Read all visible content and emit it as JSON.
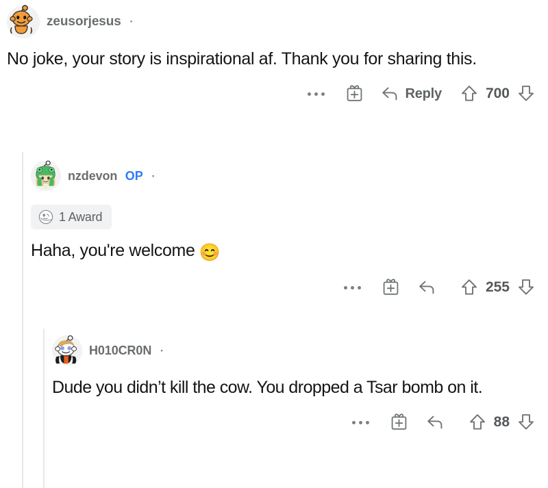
{
  "app": {
    "platform": "reddit",
    "view": "comment-thread",
    "background_color": "#ffffff",
    "text_color": "#141414",
    "meta_color": "#6f7375",
    "op_badge_color": "#2d7cf6",
    "threadline_color": "#e6e7e8"
  },
  "comments": [
    {
      "id": "comment-1",
      "depth": 0,
      "username": "zeusorjesus",
      "is_op": false,
      "op_label": "",
      "separator": "·",
      "timestamp": "",
      "avatar": {
        "name": "snoo-avatar-orange",
        "body_color": "#f29c38",
        "accent_color": "#f0882c",
        "background_color": "#f2f2f3"
      },
      "awards": null,
      "body": "No joke, your story is inspirational af. Thank you for sharing this.",
      "emoji": "",
      "actions": {
        "overflow_label": "…",
        "overflow_name": "more-options",
        "gift_label": "",
        "gift_name": "give-award",
        "reply_label": "Reply",
        "upvote_label": "",
        "score": "700",
        "downvote_label": ""
      }
    },
    {
      "id": "comment-2",
      "depth": 1,
      "username": "nzdevon",
      "is_op": true,
      "op_label": "OP",
      "separator": "·",
      "timestamp": "",
      "avatar": {
        "name": "snoo-avatar-frog-hood",
        "body_color": "#e9ddc7",
        "accent_color": "#3fae5a",
        "background_color": "#f2f2f3"
      },
      "awards": {
        "icon_name": "award-icon",
        "label": "1 Award",
        "pill_background": "#f1f2f3"
      },
      "body": "Haha, you're welcome",
      "emoji": "😊",
      "actions": {
        "overflow_label": "…",
        "overflow_name": "more-options",
        "gift_label": "",
        "gift_name": "give-award",
        "reply_label": "",
        "upvote_label": "",
        "score": "255",
        "downvote_label": ""
      }
    },
    {
      "id": "comment-3",
      "depth": 2,
      "username": "H010CR0N",
      "is_op": false,
      "op_label": "",
      "separator": "·",
      "timestamp": "",
      "avatar": {
        "name": "snoo-avatar-blond-jacket",
        "body_color": "#fdfdfd",
        "accent_color": "#e8601f",
        "background_color": "#f2f2f3"
      },
      "awards": null,
      "body": "Dude you didn’t kill the cow. You dropped a Tsar bomb on it.",
      "emoji": "",
      "actions": {
        "overflow_label": "…",
        "overflow_name": "more-options",
        "gift_label": "",
        "gift_name": "give-award",
        "reply_label": "",
        "upvote_label": "",
        "score": "88",
        "downvote_label": ""
      }
    }
  ]
}
